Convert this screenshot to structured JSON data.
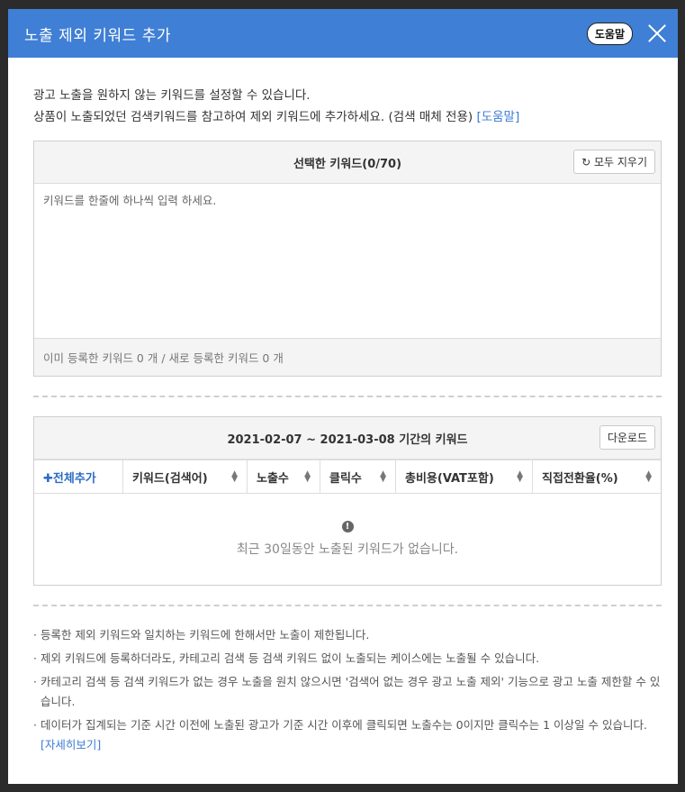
{
  "header": {
    "title": "노출 제외 키워드 추가",
    "help_label": "도움말"
  },
  "intro": {
    "line1": "광고 노출을 원하지 않는 키워드를 설정할 수 있습니다.",
    "line2": "상품이 노출되었던 검색키워드를 참고하여 제외 키워드에 추가하세요. (검색 매체 전용)",
    "help_link": "[도움말]"
  },
  "selected": {
    "title": "선택한 키워드(0/70)",
    "clear_label": "모두 지우기",
    "placeholder": "키워드를 한줄에 하나씩 입력 하세요.",
    "footer": "이미 등록한 키워드 0 개 / 새로 등록한 키워드 0 개"
  },
  "history": {
    "title": "2021-02-07 ~ 2021-03-08 기간의 키워드",
    "download_label": "다운로드",
    "add_all": "✚전체추가",
    "columns": [
      "키워드(검색어)",
      "노출수",
      "클릭수",
      "총비용(VAT포함)",
      "직접전환율(%)"
    ],
    "empty_text": "최근 30일동안 노출된 키워드가 없습니다."
  },
  "notes": {
    "n1": "등록한 제외 키워드와 일치하는 키워드에 한해서만 노출이 제한됩니다.",
    "n2": "제외 키워드에 등록하더라도, 카테고리 검색 등 검색 키워드 없이 노출되는 케이스에는 노출될 수 있습니다.",
    "n3": "카테고리 검색 등 검색 키워드가 없는 경우 노출을 원치 않으시면 '검색어 없는 경우 광고 노출 제외' 기능으로 광고 노출 제한할 수 있습니다.",
    "n4": "데이터가 집계되는 기준 시간 이전에 노출된 광고가 기준 시간 이후에 클릭되면 노출수는 0이지만 클릭수는 1 이상일 수 있습니다.",
    "n4_link": "[자세히보기]"
  }
}
